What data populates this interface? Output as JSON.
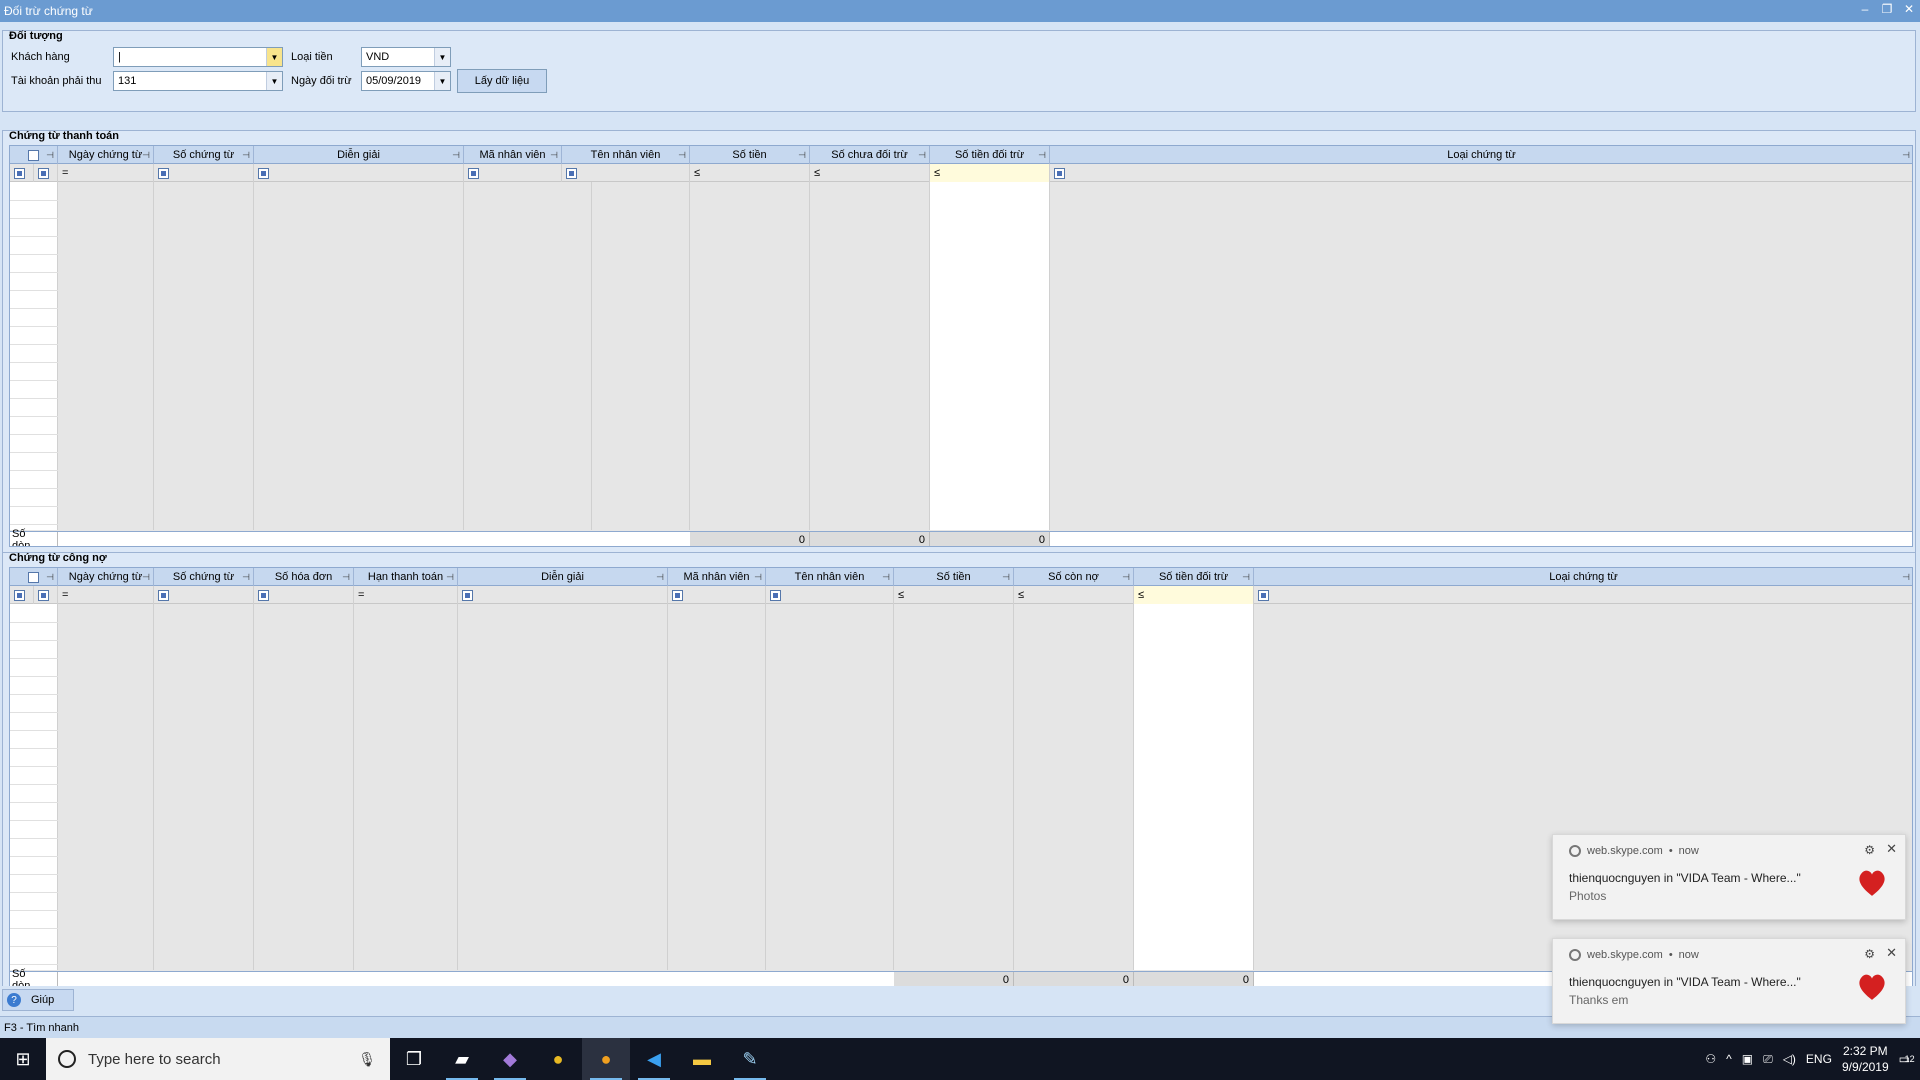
{
  "window": {
    "title": "Đối trừ chứng từ",
    "controls": [
      "–",
      "❐",
      "✕"
    ]
  },
  "doi_tuong": {
    "title": "Đối tượng",
    "khach_hang_label": "Khách hàng",
    "khach_hang_value": "|",
    "loai_tien_label": "Loại tiền",
    "loai_tien_value": "VND",
    "tai_khoan_label": "Tài khoản phải thu",
    "tai_khoan_value": "131",
    "ngay_doi_tru_label": "Ngày đối trừ",
    "ngay_doi_tru_value": "05/09/2019",
    "lay_du_lieu_button": "Lấy dữ liệu"
  },
  "thanh_toan": {
    "title": "Chứng từ thanh toán",
    "headers": [
      "Ngày chứng từ",
      "Số chứng từ",
      "Diễn giải",
      "Mã nhân viên",
      "Tên nhân viên",
      "Số tiền",
      "Số chưa đối trừ",
      "Số tiền đối trừ",
      "Loại chứng từ"
    ],
    "filters": [
      "=",
      "",
      "",
      "",
      "",
      "≤",
      "≤",
      "≤",
      ""
    ],
    "footer_label": "Số dòn...",
    "footer_values": [
      "0",
      "0",
      "0"
    ]
  },
  "cong_no": {
    "title": "Chứng từ công nợ",
    "headers": [
      "Ngày chứng từ",
      "Số chứng từ",
      "Số hóa đơn",
      "Hạn thanh toán",
      "Diễn giải",
      "Mã nhân viên",
      "Tên nhân viên",
      "Số tiền",
      "Số còn nợ",
      "Số tiền đối trừ",
      "Loại chứng từ"
    ],
    "filters": [
      "=",
      "",
      "",
      "=",
      "",
      "",
      "",
      "≤",
      "≤",
      "≤",
      ""
    ],
    "footer_label": "Số dòn...",
    "footer_values": [
      "0",
      "0",
      "0"
    ]
  },
  "help_button": "Giúp",
  "status": "F3 - Tìm nhanh",
  "taskbar": {
    "search_placeholder": "Type here to search",
    "lang": "ENG",
    "time": "2:32 PM",
    "date": "9/9/2019",
    "notif_count": "12"
  },
  "toasts": [
    {
      "source": "web.skype.com",
      "when": "now",
      "message": "thienquocnguyen in \"VIDA Team - Where...\"",
      "sub": "Photos"
    },
    {
      "source": "web.skype.com",
      "when": "now",
      "message": "thienquocnguyen in \"VIDA Team - Where...\"",
      "sub": "Thanks em"
    }
  ],
  "colors": {
    "titlebar": "#6b9bd1",
    "panel": "#d6e4f5",
    "header": "#c6d8ef",
    "taskbar": "#101522"
  }
}
